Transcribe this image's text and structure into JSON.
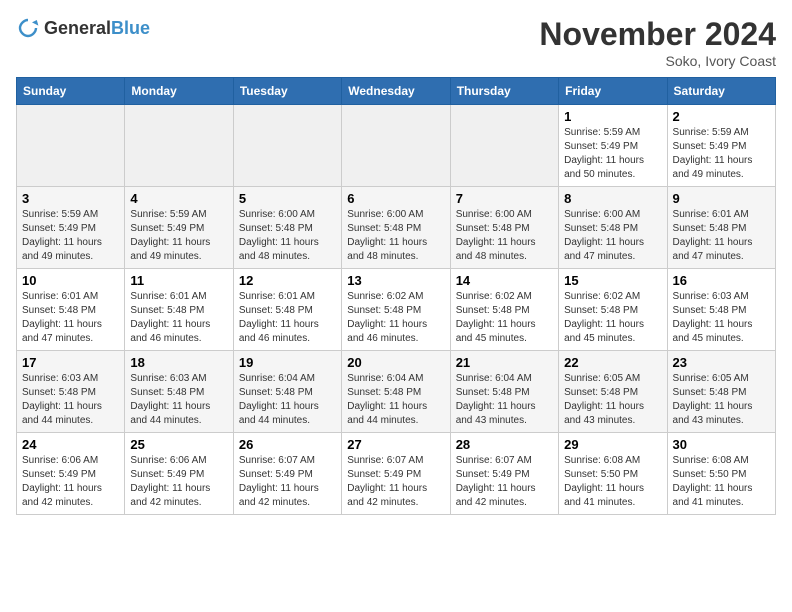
{
  "logo": {
    "general": "General",
    "blue": "Blue"
  },
  "title": "November 2024",
  "location": "Soko, Ivory Coast",
  "days_of_week": [
    "Sunday",
    "Monday",
    "Tuesday",
    "Wednesday",
    "Thursday",
    "Friday",
    "Saturday"
  ],
  "weeks": [
    [
      {
        "day": "",
        "info": ""
      },
      {
        "day": "",
        "info": ""
      },
      {
        "day": "",
        "info": ""
      },
      {
        "day": "",
        "info": ""
      },
      {
        "day": "",
        "info": ""
      },
      {
        "day": "1",
        "info": "Sunrise: 5:59 AM\nSunset: 5:49 PM\nDaylight: 11 hours\nand 50 minutes."
      },
      {
        "day": "2",
        "info": "Sunrise: 5:59 AM\nSunset: 5:49 PM\nDaylight: 11 hours\nand 49 minutes."
      }
    ],
    [
      {
        "day": "3",
        "info": "Sunrise: 5:59 AM\nSunset: 5:49 PM\nDaylight: 11 hours\nand 49 minutes."
      },
      {
        "day": "4",
        "info": "Sunrise: 5:59 AM\nSunset: 5:49 PM\nDaylight: 11 hours\nand 49 minutes."
      },
      {
        "day": "5",
        "info": "Sunrise: 6:00 AM\nSunset: 5:48 PM\nDaylight: 11 hours\nand 48 minutes."
      },
      {
        "day": "6",
        "info": "Sunrise: 6:00 AM\nSunset: 5:48 PM\nDaylight: 11 hours\nand 48 minutes."
      },
      {
        "day": "7",
        "info": "Sunrise: 6:00 AM\nSunset: 5:48 PM\nDaylight: 11 hours\nand 48 minutes."
      },
      {
        "day": "8",
        "info": "Sunrise: 6:00 AM\nSunset: 5:48 PM\nDaylight: 11 hours\nand 47 minutes."
      },
      {
        "day": "9",
        "info": "Sunrise: 6:01 AM\nSunset: 5:48 PM\nDaylight: 11 hours\nand 47 minutes."
      }
    ],
    [
      {
        "day": "10",
        "info": "Sunrise: 6:01 AM\nSunset: 5:48 PM\nDaylight: 11 hours\nand 47 minutes."
      },
      {
        "day": "11",
        "info": "Sunrise: 6:01 AM\nSunset: 5:48 PM\nDaylight: 11 hours\nand 46 minutes."
      },
      {
        "day": "12",
        "info": "Sunrise: 6:01 AM\nSunset: 5:48 PM\nDaylight: 11 hours\nand 46 minutes."
      },
      {
        "day": "13",
        "info": "Sunrise: 6:02 AM\nSunset: 5:48 PM\nDaylight: 11 hours\nand 46 minutes."
      },
      {
        "day": "14",
        "info": "Sunrise: 6:02 AM\nSunset: 5:48 PM\nDaylight: 11 hours\nand 45 minutes."
      },
      {
        "day": "15",
        "info": "Sunrise: 6:02 AM\nSunset: 5:48 PM\nDaylight: 11 hours\nand 45 minutes."
      },
      {
        "day": "16",
        "info": "Sunrise: 6:03 AM\nSunset: 5:48 PM\nDaylight: 11 hours\nand 45 minutes."
      }
    ],
    [
      {
        "day": "17",
        "info": "Sunrise: 6:03 AM\nSunset: 5:48 PM\nDaylight: 11 hours\nand 44 minutes."
      },
      {
        "day": "18",
        "info": "Sunrise: 6:03 AM\nSunset: 5:48 PM\nDaylight: 11 hours\nand 44 minutes."
      },
      {
        "day": "19",
        "info": "Sunrise: 6:04 AM\nSunset: 5:48 PM\nDaylight: 11 hours\nand 44 minutes."
      },
      {
        "day": "20",
        "info": "Sunrise: 6:04 AM\nSunset: 5:48 PM\nDaylight: 11 hours\nand 44 minutes."
      },
      {
        "day": "21",
        "info": "Sunrise: 6:04 AM\nSunset: 5:48 PM\nDaylight: 11 hours\nand 43 minutes."
      },
      {
        "day": "22",
        "info": "Sunrise: 6:05 AM\nSunset: 5:48 PM\nDaylight: 11 hours\nand 43 minutes."
      },
      {
        "day": "23",
        "info": "Sunrise: 6:05 AM\nSunset: 5:48 PM\nDaylight: 11 hours\nand 43 minutes."
      }
    ],
    [
      {
        "day": "24",
        "info": "Sunrise: 6:06 AM\nSunset: 5:49 PM\nDaylight: 11 hours\nand 42 minutes."
      },
      {
        "day": "25",
        "info": "Sunrise: 6:06 AM\nSunset: 5:49 PM\nDaylight: 11 hours\nand 42 minutes."
      },
      {
        "day": "26",
        "info": "Sunrise: 6:07 AM\nSunset: 5:49 PM\nDaylight: 11 hours\nand 42 minutes."
      },
      {
        "day": "27",
        "info": "Sunrise: 6:07 AM\nSunset: 5:49 PM\nDaylight: 11 hours\nand 42 minutes."
      },
      {
        "day": "28",
        "info": "Sunrise: 6:07 AM\nSunset: 5:49 PM\nDaylight: 11 hours\nand 42 minutes."
      },
      {
        "day": "29",
        "info": "Sunrise: 6:08 AM\nSunset: 5:50 PM\nDaylight: 11 hours\nand 41 minutes."
      },
      {
        "day": "30",
        "info": "Sunrise: 6:08 AM\nSunset: 5:50 PM\nDaylight: 11 hours\nand 41 minutes."
      }
    ]
  ]
}
